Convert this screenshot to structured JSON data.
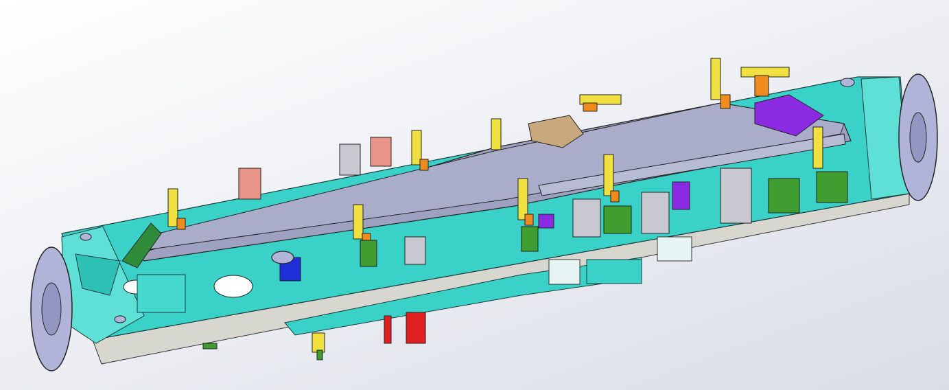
{
  "viewport": {
    "background_top": "#ffffff",
    "background_bottom": "#d9dde6"
  },
  "model": {
    "description_shown": false,
    "colors": {
      "base_plate": "#3ad2c8",
      "base_plate_dark": "#1fa9a2",
      "base_edge": "#d7d7cf",
      "part_panel": "#9ea2c0",
      "part_panel_dark": "#7f83a6",
      "clamp_yellow": "#f0e040",
      "clamp_orange": "#f08c1e",
      "block_green": "#3f9e2f",
      "block_gray": "#c8c8d0",
      "block_pink": "#e89488",
      "block_purple": "#8a2be2",
      "block_blue": "#1f2fd8",
      "block_tan": "#c8a87c",
      "block_red": "#e02020",
      "wheel": "#b0b4d8"
    }
  }
}
